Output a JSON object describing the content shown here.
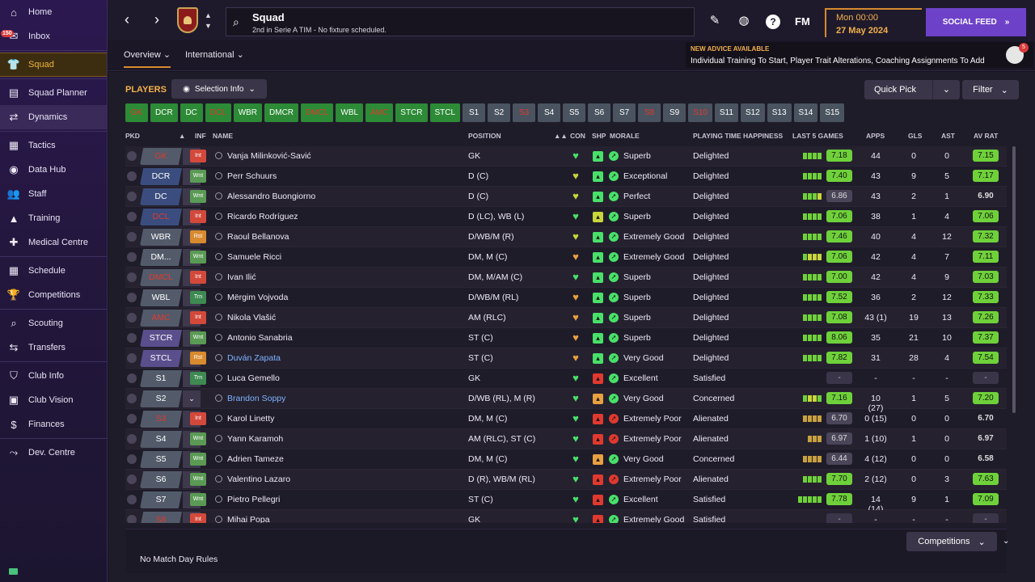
{
  "sidebar": {
    "items": [
      {
        "label": "Home",
        "icon": "home-icon",
        "glyph": "⌂"
      },
      {
        "label": "Inbox",
        "icon": "inbox-icon",
        "glyph": "✉",
        "badge": "150"
      },
      {
        "label": "Squad",
        "icon": "shirt-icon",
        "glyph": "👕",
        "active": true
      },
      {
        "label": "Squad Planner",
        "icon": "planner-icon",
        "glyph": "▤"
      },
      {
        "label": "Dynamics",
        "icon": "handshake-icon",
        "glyph": "⇄"
      },
      {
        "label": "Tactics",
        "icon": "tactics-icon",
        "glyph": "▦"
      },
      {
        "label": "Data Hub",
        "icon": "datahub-icon",
        "glyph": "◉"
      },
      {
        "label": "Staff",
        "icon": "staff-icon",
        "glyph": "👥"
      },
      {
        "label": "Training",
        "icon": "training-icon",
        "glyph": "▲"
      },
      {
        "label": "Medical Centre",
        "icon": "medical-icon",
        "glyph": "✚"
      },
      {
        "label": "Schedule",
        "icon": "calendar-icon",
        "glyph": "▦"
      },
      {
        "label": "Competitions",
        "icon": "trophy-icon",
        "glyph": "🏆"
      },
      {
        "label": "Scouting",
        "icon": "scouting-icon",
        "glyph": "⌕"
      },
      {
        "label": "Transfers",
        "icon": "transfers-icon",
        "glyph": "⇆"
      },
      {
        "label": "Club Info",
        "icon": "shield-icon",
        "glyph": "⛉"
      },
      {
        "label": "Club Vision",
        "icon": "briefcase-icon",
        "glyph": "▣"
      },
      {
        "label": "Finances",
        "icon": "finances-icon",
        "glyph": "$"
      },
      {
        "label": "Dev. Centre",
        "icon": "dev-centre-icon",
        "glyph": "⤳"
      }
    ]
  },
  "topbar": {
    "title": "Squad",
    "subtitle": "2nd in Serie A TIM - No fixture scheduled.",
    "fm_label": "FM",
    "date_line1": "Mon 00:00",
    "date_line2": "27 May 2024",
    "social_label": "SOCIAL FEED",
    "help_label": "?"
  },
  "subbar": {
    "tab_overview": "Overview",
    "tab_international": "International",
    "advice_title": "NEW ADVICE AVAILABLE",
    "advice_text": "Individual Training To Start, Player Trait Alterations, Coaching Assignments To Add",
    "advice_badge": "5"
  },
  "toolbar": {
    "players_title": "PLAYERS",
    "selection_info": "Selection Info",
    "quick_pick": "Quick Pick",
    "filter": "Filter"
  },
  "positions": [
    {
      "label": "GK",
      "style": "r"
    },
    {
      "label": "DCR",
      "style": "g"
    },
    {
      "label": "DC",
      "style": "g"
    },
    {
      "label": "DCL",
      "style": "r"
    },
    {
      "label": "WBR",
      "style": "g"
    },
    {
      "label": "DMCR",
      "style": "g"
    },
    {
      "label": "DMCL",
      "style": "r"
    },
    {
      "label": "WBL",
      "style": "g"
    },
    {
      "label": "AMC",
      "style": "r"
    },
    {
      "label": "STCR",
      "style": "g"
    },
    {
      "label": "STCL",
      "style": "g"
    },
    {
      "label": "S1",
      "style": "s"
    },
    {
      "label": "S2",
      "style": "s"
    },
    {
      "label": "S3",
      "style": "sr"
    },
    {
      "label": "S4",
      "style": "s"
    },
    {
      "label": "S5",
      "style": "s"
    },
    {
      "label": "S6",
      "style": "s"
    },
    {
      "label": "S7",
      "style": "s"
    },
    {
      "label": "S8",
      "style": "sr"
    },
    {
      "label": "S9",
      "style": "s"
    },
    {
      "label": "S10",
      "style": "sr"
    },
    {
      "label": "S11",
      "style": "s"
    },
    {
      "label": "S12",
      "style": "s"
    },
    {
      "label": "S13",
      "style": "s"
    },
    {
      "label": "S14",
      "style": "s"
    },
    {
      "label": "S15",
      "style": "s"
    }
  ],
  "columns": {
    "pkd": "PKD",
    "inf": "INF",
    "name": "NAME",
    "position": "POSITION",
    "con": "CON",
    "shp": "SHP",
    "morale": "MORALE",
    "pth": "PLAYING TIME HAPPINESS",
    "last5": "LAST 5 GAMES",
    "apps": "APPS",
    "gls": "GLS",
    "ast": "AST",
    "avrat": "AV RAT"
  },
  "colors": {
    "green": "#6fd13a",
    "red": "#e0392f",
    "orange": "#f3b04a",
    "purple": "#6d42c8"
  },
  "players": [
    {
      "pkd": "GK",
      "pkdColor": "gy",
      "pkdRed": true,
      "inf": "Int",
      "name": "Vanja Milinković-Savić",
      "pos": "GK",
      "con": "#49e06a",
      "shp": "#49e06a",
      "mor": "#49e06a",
      "morale": "Superb",
      "pth": "Delighted",
      "bars": [
        "#6fd13a",
        "#6fd13a",
        "#6fd13a",
        "#6fd13a"
      ],
      "rat": "7.18",
      "ratC": "gr",
      "apps": "44",
      "gls": "0",
      "ast": "0",
      "avrat": "7.15",
      "avC": "gr"
    },
    {
      "pkd": "DCR",
      "pkdColor": "bl",
      "inf": "Wnt",
      "name": "Perr Schuurs",
      "pos": "D (C)",
      "con": "#c8d63a",
      "shp": "#49e06a",
      "mor": "#49e06a",
      "morale": "Exceptional",
      "pth": "Delighted",
      "bars": [
        "#6fd13a",
        "#6fd13a",
        "#6fd13a",
        "#6fd13a"
      ],
      "rat": "7.40",
      "ratC": "gr",
      "apps": "43",
      "gls": "9",
      "ast": "5",
      "avrat": "7.17",
      "avC": "gr"
    },
    {
      "pkd": "DC",
      "pkdColor": "bl",
      "inf": "Wnt",
      "name": "Alessandro Buongiorno",
      "pos": "D (C)",
      "con": "#c8d63a",
      "shp": "#49e06a",
      "mor": "#49e06a",
      "morale": "Perfect",
      "pth": "Delighted",
      "bars": [
        "#6fd13a",
        "#6fd13a",
        "#6fd13a",
        "#c8d63a"
      ],
      "rat": "6.86",
      "ratC": "gy",
      "apps": "43",
      "gls": "2",
      "ast": "1",
      "avrat": "6.90",
      "avC": "none"
    },
    {
      "pkd": "DCL",
      "pkdColor": "bl",
      "pkdRed": true,
      "inf": "Int",
      "name": "Ricardo Rodríguez",
      "pos": "D (LC), WB (L)",
      "con": "#49e06a",
      "shp": "#c8d63a",
      "mor": "#49e06a",
      "morale": "Superb",
      "pth": "Delighted",
      "bars": [
        "#6fd13a",
        "#6fd13a",
        "#6fd13a",
        "#6fd13a"
      ],
      "rat": "7.06",
      "ratC": "gr",
      "apps": "38",
      "gls": "1",
      "ast": "4",
      "avrat": "7.06",
      "avC": "gr"
    },
    {
      "pkd": "WBR",
      "pkdColor": "gy",
      "inf": "Rst",
      "name": "Raoul Bellanova",
      "pos": "D/WB/M (R)",
      "con": "#c8d63a",
      "shp": "#49e06a",
      "mor": "#49e06a",
      "morale": "Extremely Good",
      "pth": "Delighted",
      "bars": [
        "#6fd13a",
        "#6fd13a",
        "#6fd13a",
        "#6fd13a"
      ],
      "rat": "7.46",
      "ratC": "gr",
      "apps": "40",
      "gls": "4",
      "ast": "12",
      "avrat": "7.32",
      "avC": "gr"
    },
    {
      "pkd": "DM...",
      "pkdColor": "gy",
      "inf": "Wnt",
      "name": "Samuele Ricci",
      "pos": "DM, M (C)",
      "con": "#e8a040",
      "shp": "#49e06a",
      "mor": "#49e06a",
      "morale": "Extremely Good",
      "pth": "Delighted",
      "bars": [
        "#6fd13a",
        "#c8d63a",
        "#c8d63a",
        "#c8d63a"
      ],
      "rat": "7.06",
      "ratC": "gr",
      "apps": "42",
      "gls": "4",
      "ast": "7",
      "avrat": "7.11",
      "avC": "gr"
    },
    {
      "pkd": "DMCL",
      "pkdColor": "gy",
      "pkdRed": true,
      "inf": "Int",
      "name": "Ivan Ilić",
      "pos": "DM, M/AM (C)",
      "con": "#49e06a",
      "shp": "#49e06a",
      "mor": "#49e06a",
      "morale": "Superb",
      "pth": "Delighted",
      "bars": [
        "#6fd13a",
        "#6fd13a",
        "#6fd13a",
        "#6fd13a"
      ],
      "rat": "7.00",
      "ratC": "gr",
      "apps": "42",
      "gls": "4",
      "ast": "9",
      "avrat": "7.03",
      "avC": "gr"
    },
    {
      "pkd": "WBL",
      "pkdColor": "gy",
      "inf": "Trn",
      "name": "Mërgim Vojvoda",
      "pos": "D/WB/M (RL)",
      "con": "#e8a040",
      "shp": "#49e06a",
      "mor": "#49e06a",
      "morale": "Superb",
      "pth": "Delighted",
      "bars": [
        "#6fd13a",
        "#6fd13a",
        "#6fd13a",
        "#6fd13a"
      ],
      "rat": "7.52",
      "ratC": "gr",
      "apps": "36",
      "gls": "2",
      "ast": "12",
      "avrat": "7.33",
      "avC": "gr"
    },
    {
      "pkd": "AMC",
      "pkdColor": "gy",
      "pkdRed": true,
      "inf": "Int",
      "name": "Nikola Vlašić",
      "pos": "AM (RLC)",
      "con": "#e8a040",
      "shp": "#49e06a",
      "mor": "#49e06a",
      "morale": "Superb",
      "pth": "Delighted",
      "bars": [
        "#6fd13a",
        "#6fd13a",
        "#6fd13a",
        "#6fd13a"
      ],
      "rat": "7.08",
      "ratC": "gr",
      "apps": "43 (1)",
      "gls": "19",
      "ast": "13",
      "avrat": "7.26",
      "avC": "gr"
    },
    {
      "pkd": "STCR",
      "pkdColor": "pu",
      "inf": "Wnt",
      "name": "Antonio Sanabria",
      "pos": "ST (C)",
      "con": "#e8a040",
      "shp": "#49e06a",
      "mor": "#49e06a",
      "morale": "Superb",
      "pth": "Delighted",
      "bars": [
        "#6fd13a",
        "#6fd13a",
        "#6fd13a",
        "#6fd13a"
      ],
      "rat": "8.06",
      "ratC": "gr",
      "apps": "35",
      "gls": "21",
      "ast": "10",
      "avrat": "7.37",
      "avC": "gr"
    },
    {
      "pkd": "STCL",
      "pkdColor": "pu",
      "inf": "Rst",
      "name": "Duván Zapata",
      "nameBlue": true,
      "pos": "ST (C)",
      "con": "#e8a040",
      "shp": "#49e06a",
      "mor": "#49e06a",
      "morale": "Very Good",
      "pth": "Delighted",
      "bars": [
        "#6fd13a",
        "#6fd13a",
        "#6fd13a",
        "#6fd13a"
      ],
      "rat": "7.82",
      "ratC": "gr",
      "apps": "31",
      "gls": "28",
      "ast": "4",
      "avrat": "7.54",
      "avC": "gr"
    },
    {
      "pkd": "S1",
      "pkdColor": "gy",
      "inf": "Trn",
      "name": "Luca Gemello",
      "pos": "GK",
      "con": "#49e06a",
      "shp": "#e0392f",
      "mor": "#49e06a",
      "morale": "Excellent",
      "pth": "Satisfied",
      "bars": [],
      "rat": "-",
      "ratC": "dash",
      "apps": "-",
      "gls": "-",
      "ast": "-",
      "avrat": "-",
      "avC": "dash"
    },
    {
      "pkd": "S2",
      "pkdColor": "gy",
      "inf": "",
      "name": "Brandon Soppy",
      "nameBlue": true,
      "pos": "D/WB (RL), M (R)",
      "con": "#49e06a",
      "shp": "#e8a040",
      "mor": "#49e06a",
      "morale": "Very Good",
      "pth": "Concerned",
      "bars": [
        "#6fd13a",
        "#c8d63a",
        "#c8d63a",
        "#6fd13a"
      ],
      "rat": "7.16",
      "ratC": "gr",
      "apps": "10 (27)",
      "gls": "1",
      "ast": "5",
      "avrat": "7.20",
      "avC": "gr"
    },
    {
      "pkd": "S3",
      "pkdColor": "gy",
      "pkdRed": true,
      "inf": "Int",
      "name": "Karol Linetty",
      "pos": "DM, M (C)",
      "con": "#49e06a",
      "shp": "#e0392f",
      "mor": "#e0392f",
      "morale": "Extremely Poor",
      "pth": "Alienated",
      "bars": [
        "#c8a040",
        "#c8a040",
        "#c8a040",
        "#c8a040"
      ],
      "rat": "6.70",
      "ratC": "gy",
      "apps": "0 (15)",
      "gls": "0",
      "ast": "0",
      "avrat": "6.70",
      "avC": "none"
    },
    {
      "pkd": "S4",
      "pkdColor": "gy",
      "inf": "Wnt",
      "name": "Yann Karamoh",
      "pos": "AM (RLC), ST (C)",
      "con": "#49e06a",
      "shp": "#e0392f",
      "mor": "#e0392f",
      "morale": "Extremely Poor",
      "pth": "Alienated",
      "bars": [
        "#c8a040",
        "#c8a040",
        "#c8a040"
      ],
      "rat": "6.97",
      "ratC": "gy",
      "apps": "1 (10)",
      "gls": "1",
      "ast": "0",
      "avrat": "6.97",
      "avC": "none"
    },
    {
      "pkd": "S5",
      "pkdColor": "gy",
      "inf": "Wnt",
      "name": "Adrien Tameze",
      "pos": "DM, M (C)",
      "con": "#49e06a",
      "shp": "#e8a040",
      "mor": "#49e06a",
      "morale": "Very Good",
      "pth": "Concerned",
      "bars": [
        "#c8a040",
        "#c8a040",
        "#c8a040",
        "#c8a040"
      ],
      "rat": "6.44",
      "ratC": "gy",
      "apps": "4 (12)",
      "gls": "0",
      "ast": "0",
      "avrat": "6.58",
      "avC": "none"
    },
    {
      "pkd": "S6",
      "pkdColor": "gy",
      "inf": "Wnt",
      "name": "Valentino Lazaro",
      "pos": "D (R), WB/M (RL)",
      "con": "#49e06a",
      "shp": "#e0392f",
      "mor": "#e0392f",
      "morale": "Extremely Poor",
      "pth": "Alienated",
      "bars": [
        "#6fd13a",
        "#6fd13a",
        "#6fd13a",
        "#6fd13a"
      ],
      "rat": "7.70",
      "ratC": "gr",
      "apps": "2 (12)",
      "gls": "0",
      "ast": "3",
      "avrat": "7.63",
      "avC": "gr"
    },
    {
      "pkd": "S7",
      "pkdColor": "gy",
      "inf": "Wnt",
      "name": "Pietro Pellegri",
      "pos": "ST (C)",
      "con": "#49e06a",
      "shp": "#e0392f",
      "mor": "#49e06a",
      "morale": "Excellent",
      "pth": "Satisfied",
      "bars": [
        "#6fd13a",
        "#6fd13a",
        "#6fd13a",
        "#6fd13a",
        "#6fd13a"
      ],
      "rat": "7.78",
      "ratC": "gr",
      "apps": "14 (14)",
      "gls": "9",
      "ast": "1",
      "avrat": "7.09",
      "avC": "gr"
    },
    {
      "pkd": "S8",
      "pkdColor": "gy",
      "pkdRed": true,
      "inf": "Int",
      "name": "Mihai Popa",
      "pos": "GK",
      "con": "#49e06a",
      "shp": "#e0392f",
      "mor": "#49e06a",
      "morale": "Extremely Good",
      "pth": "Satisfied",
      "bars": [],
      "rat": "-",
      "ratC": "dash",
      "apps": "-",
      "gls": "-",
      "ast": "-",
      "avrat": "-",
      "avC": "dash"
    }
  ],
  "bottom": {
    "no_match": "No Match Day Rules",
    "competitions": "Competitions"
  }
}
